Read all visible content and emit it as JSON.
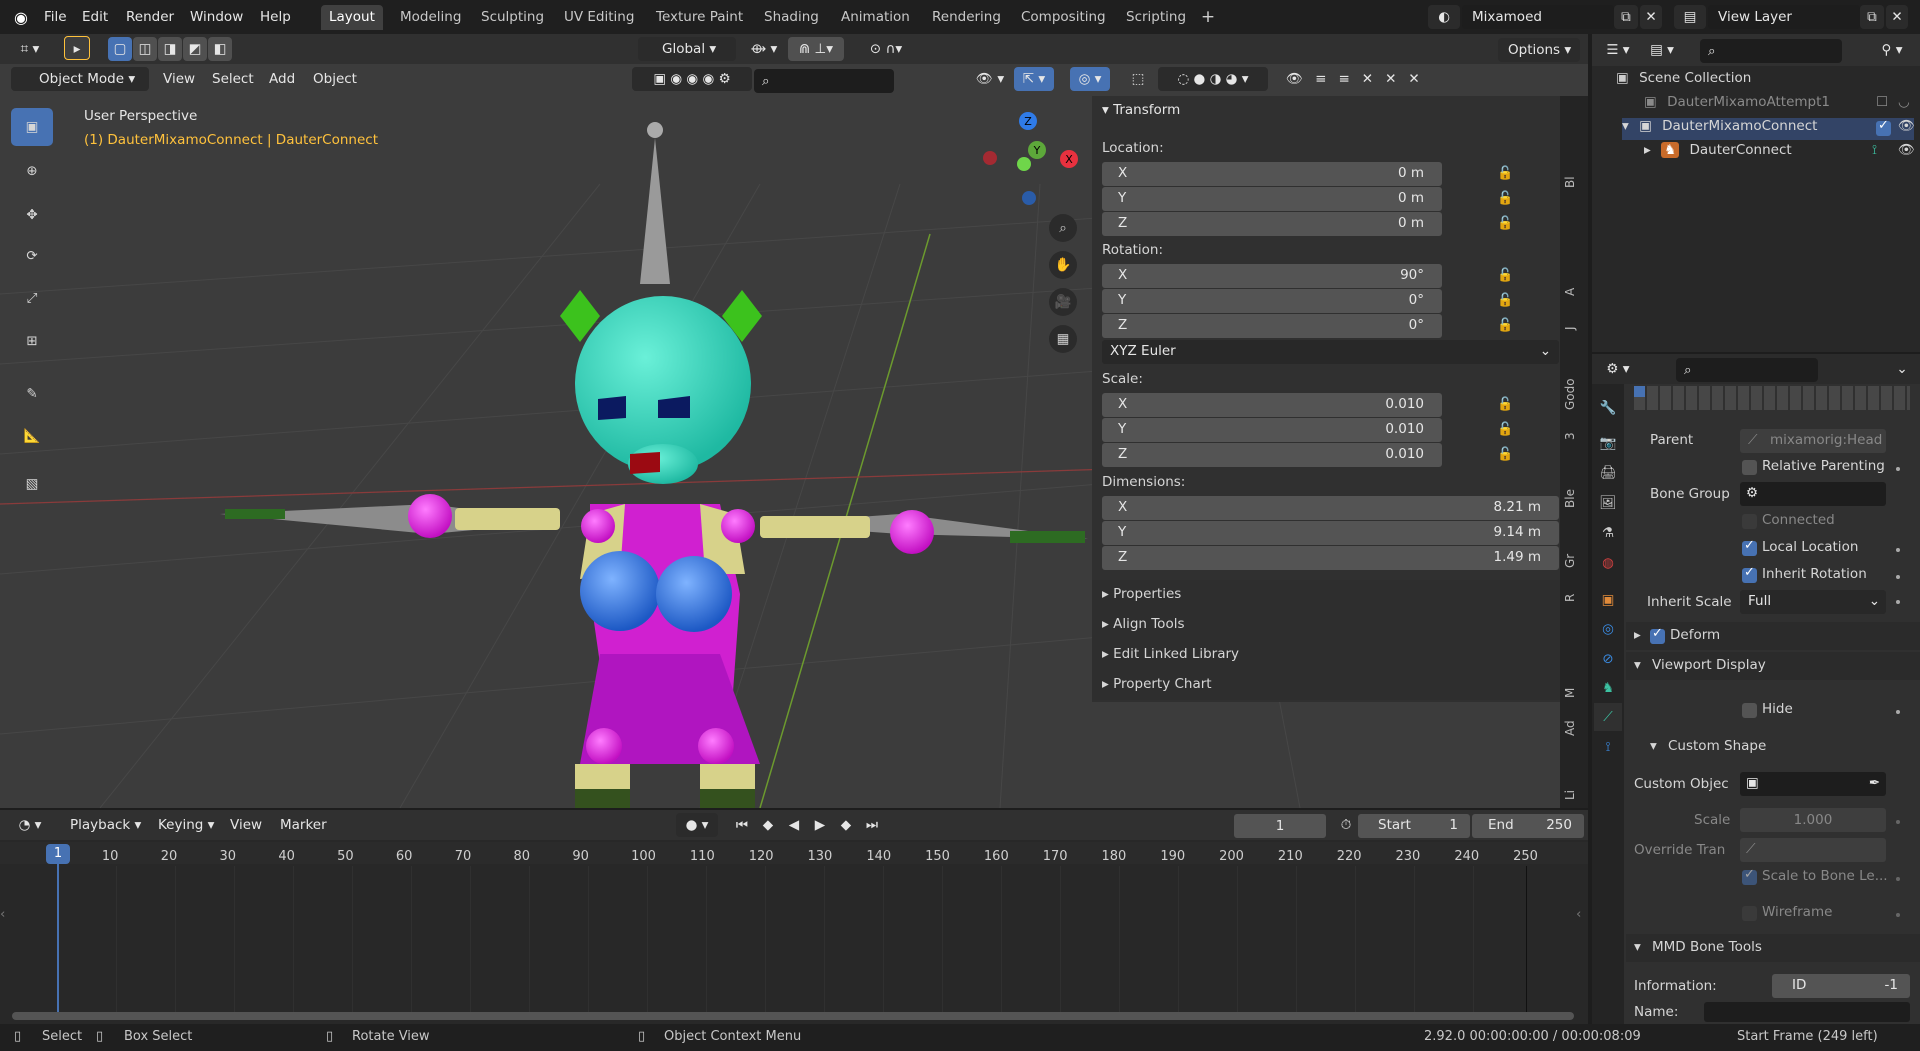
{
  "topbar": {
    "menus": [
      "File",
      "Edit",
      "Render",
      "Window",
      "Help"
    ],
    "workspaces": [
      "Layout",
      "Modeling",
      "Sculpting",
      "UV Editing",
      "Texture Paint",
      "Shading",
      "Animation",
      "Rendering",
      "Compositing",
      "Scripting"
    ],
    "active_workspace": "Layout",
    "scene_name": "Mixamoed",
    "view_layer": "View Layer"
  },
  "viewport_header": {
    "mode": "Object Mode",
    "menus": [
      "View",
      "Select",
      "Add",
      "Object"
    ],
    "orientation": "Global",
    "options": "Options"
  },
  "viewport": {
    "perspective_label": "User Perspective",
    "object_label": "(1) DauterMixamoConnect | DauterConnect",
    "gizmo": {
      "x": "X",
      "y": "Y",
      "z": "Z"
    }
  },
  "transform": {
    "title": "Transform",
    "location_label": "Location:",
    "location": [
      {
        "axis": "X",
        "value": "0 m"
      },
      {
        "axis": "Y",
        "value": "0 m"
      },
      {
        "axis": "Z",
        "value": "0 m"
      }
    ],
    "rotation_label": "Rotation:",
    "rotation": [
      {
        "axis": "X",
        "value": "90°"
      },
      {
        "axis": "Y",
        "value": "0°"
      },
      {
        "axis": "Z",
        "value": "0°"
      }
    ],
    "rotation_mode": "XYZ Euler",
    "scale_label": "Scale:",
    "scale": [
      {
        "axis": "X",
        "value": "0.010"
      },
      {
        "axis": "Y",
        "value": "0.010"
      },
      {
        "axis": "Z",
        "value": "0.010"
      }
    ],
    "dimensions_label": "Dimensions:",
    "dimensions": [
      {
        "axis": "X",
        "value": "8.21 m"
      },
      {
        "axis": "Y",
        "value": "9.14 m"
      },
      {
        "axis": "Z",
        "value": "1.49 m"
      }
    ],
    "collapsed_panels": [
      "Properties",
      "Align Tools",
      "Edit Linked Library",
      "Property Chart"
    ]
  },
  "sidebar_tabs": [
    "Bl",
    "A",
    "J",
    "Godo",
    "3",
    "Ble",
    "Gr",
    "R",
    "M",
    "Ad",
    "Li"
  ],
  "outliner": {
    "root": "Scene Collection",
    "items": [
      {
        "name": "DauterMixamoAttempt1",
        "dimmed": true
      },
      {
        "name": "DauterMixamoConnect",
        "dimmed": false
      },
      {
        "name": "DauterConnect",
        "dimmed": false
      }
    ]
  },
  "properties": {
    "parent_label": "Parent",
    "parent_value": "mixamorig:Head",
    "relative_parenting": "Relative Parenting",
    "bone_group_label": "Bone Group",
    "connected": "Connected",
    "local_location": "Local Location",
    "inherit_rotation": "Inherit Rotation",
    "inherit_scale_label": "Inherit Scale",
    "inherit_scale_value": "Full",
    "deform": "Deform",
    "viewport_display": "Viewport Display",
    "hide": "Hide",
    "custom_shape": "Custom Shape",
    "custom_object_label": "Custom Objec",
    "scale_label": "Scale",
    "scale_value": "1.000",
    "override_label": "Override Tran",
    "scale_to_bone": "Scale to Bone Le...",
    "wireframe": "Wireframe",
    "mmd_title": "MMD Bone Tools",
    "information_label": "Information:",
    "id_label": "ID",
    "id_value": "-1",
    "name_label": "Name:"
  },
  "timeline": {
    "menus": [
      "Playback",
      "Keying",
      "View",
      "Marker"
    ],
    "current_frame": "1",
    "start_label": "Start",
    "start_value": "1",
    "end_label": "End",
    "end_value": "250",
    "ticks": [
      "1",
      "10",
      "20",
      "30",
      "40",
      "50",
      "60",
      "70",
      "80",
      "90",
      "100",
      "110",
      "120",
      "130",
      "140",
      "150",
      "160",
      "170",
      "180",
      "190",
      "200",
      "210",
      "220",
      "230",
      "240",
      "250"
    ]
  },
  "statusbar": {
    "select": "Select",
    "box_select": "Box Select",
    "rotate_view": "Rotate View",
    "context_menu": "Object Context Menu",
    "version_time": "2.92.0  00:00:00:00 / 00:00:08:09",
    "start_frame": "Start Frame (249 left)"
  },
  "colors": {
    "accent": "#4772b3",
    "header": "#2b2b2b",
    "panel": "#303030",
    "field": "#545454",
    "object_label": "#ffc23c"
  }
}
